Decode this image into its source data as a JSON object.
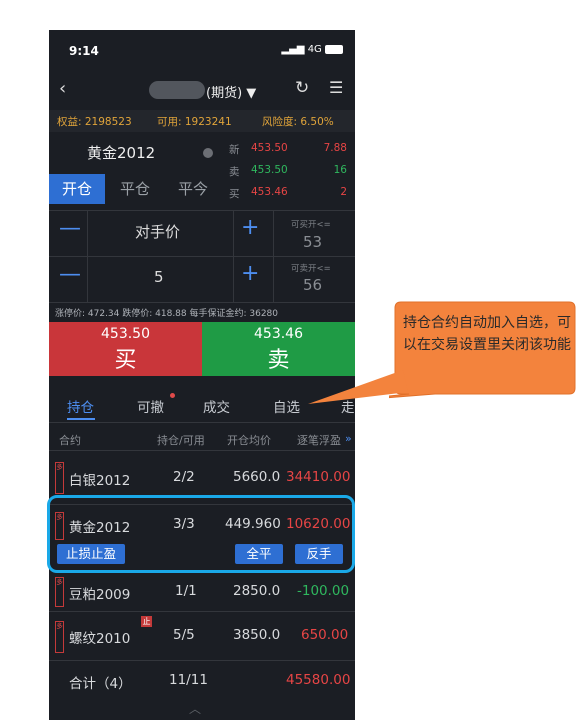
{
  "status": {
    "time": "9:14",
    "signal": "4G"
  },
  "nav": {
    "title": "(期货) ▼",
    "back_icon": "chevron-left-icon",
    "refresh_icon": "refresh-icon",
    "menu_icon": "menu-icon"
  },
  "account": {
    "equity": "权益: 2198523",
    "available": "可用: 1923241",
    "risk": "风险度:  6.50%"
  },
  "contract": {
    "name": "黄金2012",
    "quotes": [
      {
        "label": "新",
        "price": "453.50",
        "value": "7.88"
      },
      {
        "label": "卖",
        "price": "453.50",
        "value": "16"
      },
      {
        "label": "买",
        "price": "453.46",
        "value": "2"
      }
    ]
  },
  "order_tabs": [
    "开仓",
    "平仓",
    "平今"
  ],
  "order": {
    "price_mode": "对手价",
    "quantity": "5",
    "max_buy_label": "可买开<=",
    "max_buy_value": "53",
    "max_sell_label": "可卖开<=",
    "max_sell_value": "56",
    "limits": "涨停价: 472.34   跌停价: 418.88   每手保证金约: 36280"
  },
  "buy": {
    "price": "453.50",
    "label": "买"
  },
  "sell": {
    "price": "453.46",
    "label": "卖"
  },
  "callout": {
    "text": "持仓合约自动加入自选，可以在交易设置里关闭该功能"
  },
  "position_tabs": [
    "持仓",
    "可撤",
    "成交",
    "自选",
    "走"
  ],
  "table": {
    "headers": [
      "合约",
      "持仓/可用",
      "开仓均价",
      "逐笔浮盈"
    ],
    "rows": [
      {
        "dir": "多",
        "name": "白银2012",
        "pos": "2/2",
        "avg": "5660.0",
        "pnl": "34410.00"
      },
      {
        "dir": "多",
        "name": "黄金2012",
        "pos": "3/3",
        "avg": "449.960",
        "pnl": "10620.00"
      },
      {
        "dir": "多",
        "name": "豆粕2009",
        "pos": "1/1",
        "avg": "2850.0",
        "pnl": "-100.00"
      },
      {
        "dir": "多",
        "name": "螺纹2010",
        "pos": "5/5",
        "avg": "3850.0",
        "pnl": "650.00",
        "badge": "止"
      }
    ],
    "total_label": "合计（4）",
    "total_pos": "11/11",
    "total_pnl": "45580.00"
  },
  "row_actions": {
    "stop": "止损止盈",
    "close_all": "全平",
    "reverse": "反手"
  },
  "colors": {
    "accent": "#2e6fd3",
    "buy": "#c9363a",
    "sell": "#1f9b45",
    "highlight": "#1aa9e8",
    "callout": "#f3833d"
  }
}
